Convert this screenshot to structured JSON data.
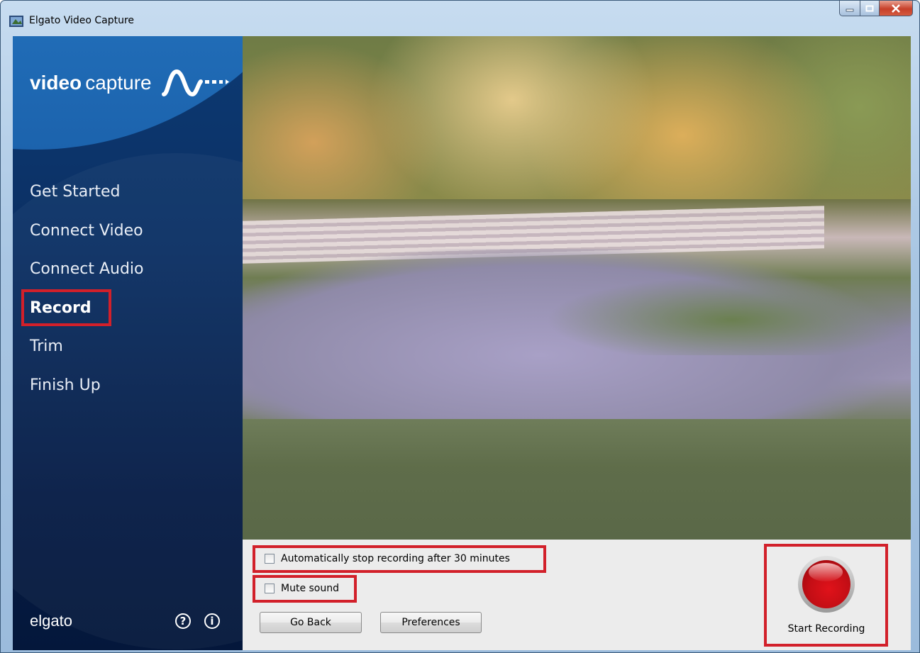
{
  "window": {
    "title": "Elgato Video Capture"
  },
  "sidebar": {
    "logo_bold": "video",
    "logo_light": "capture",
    "nav": [
      {
        "label": "Get Started",
        "active": false
      },
      {
        "label": "Connect Video",
        "active": false
      },
      {
        "label": "Connect Audio",
        "active": false
      },
      {
        "label": "Record",
        "active": true
      },
      {
        "label": "Trim",
        "active": false
      },
      {
        "label": "Finish Up",
        "active": false
      }
    ],
    "brand": "elgato",
    "help_glyph": "?",
    "info_glyph": "i"
  },
  "controls": {
    "auto_stop_label": "Automatically stop recording after 30 minutes",
    "auto_stop_checked": false,
    "mute_label": "Mute sound",
    "mute_checked": false,
    "go_back_label": "Go Back",
    "preferences_label": "Preferences",
    "start_recording_label": "Start Recording"
  },
  "colors": {
    "highlight": "#d2202a",
    "sidebar": "#0b2f63",
    "accent": "#2f89d1"
  },
  "icons": [
    "app-icon",
    "minimize-icon",
    "maximize-icon",
    "close-icon",
    "wave-logo-icon",
    "help-icon",
    "info-icon",
    "record-icon"
  ]
}
